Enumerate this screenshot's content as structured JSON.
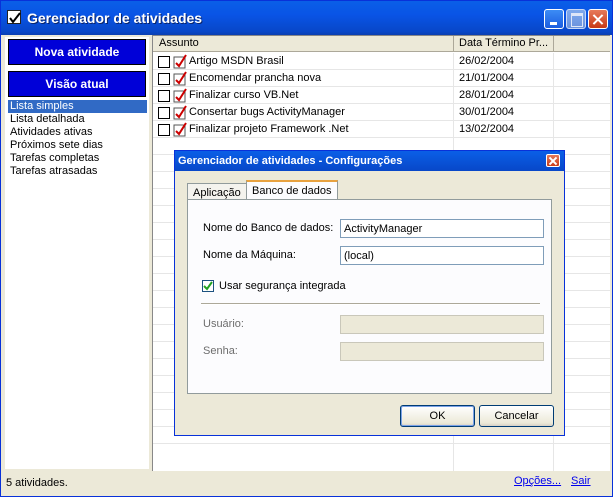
{
  "window": {
    "title": "Gerenciador de atividades"
  },
  "sidebar": {
    "new_activity_label": "Nova atividade",
    "current_view_label": "Visão atual",
    "views": [
      "Lista simples",
      "Lista detalhada",
      "Atividades ativas",
      "Próximos sete dias",
      "Tarefas completas",
      "Tarefas atrasadas"
    ],
    "selected_view": "Lista simples"
  },
  "grid": {
    "columns": [
      "Assunto",
      "Data Término Pr..."
    ],
    "rows": [
      {
        "subject": "Artigo MSDN Brasil",
        "date": "26/02/2004",
        "done": false
      },
      {
        "subject": "Encomendar prancha nova",
        "date": "21/01/2004",
        "done": false
      },
      {
        "subject": "Finalizar curso VB.Net",
        "date": "28/01/2004",
        "done": false
      },
      {
        "subject": "Consertar bugs ActivityManager",
        "date": "30/01/2004",
        "done": false
      },
      {
        "subject": "Finalizar projeto Framework .Net",
        "date": "13/02/2004",
        "done": false
      }
    ]
  },
  "status": {
    "count_text": "5 atividades.",
    "options_link": "Opções...",
    "exit_link": "Sair"
  },
  "dialog": {
    "title": "Gerenciador de atividades - Configurações",
    "tabs": [
      "Aplicação",
      "Banco de dados"
    ],
    "active_tab": "Banco de dados",
    "db_name_label": "Nome do Banco de dados:",
    "db_name_value": "ActivityManager",
    "machine_label": "Nome da Máquina:",
    "machine_value": "(local)",
    "integrated_security_label": "Usar segurança integrada",
    "integrated_security_checked": true,
    "user_label": "Usuário:",
    "user_value": "",
    "password_label": "Senha:",
    "password_value": "",
    "ok_label": "OK",
    "cancel_label": "Cancelar"
  },
  "colors": {
    "titlebar": "#0a5fe7",
    "sidebar_button": "#0000d8",
    "selection": "#316ac5",
    "link": "#0000ee"
  }
}
